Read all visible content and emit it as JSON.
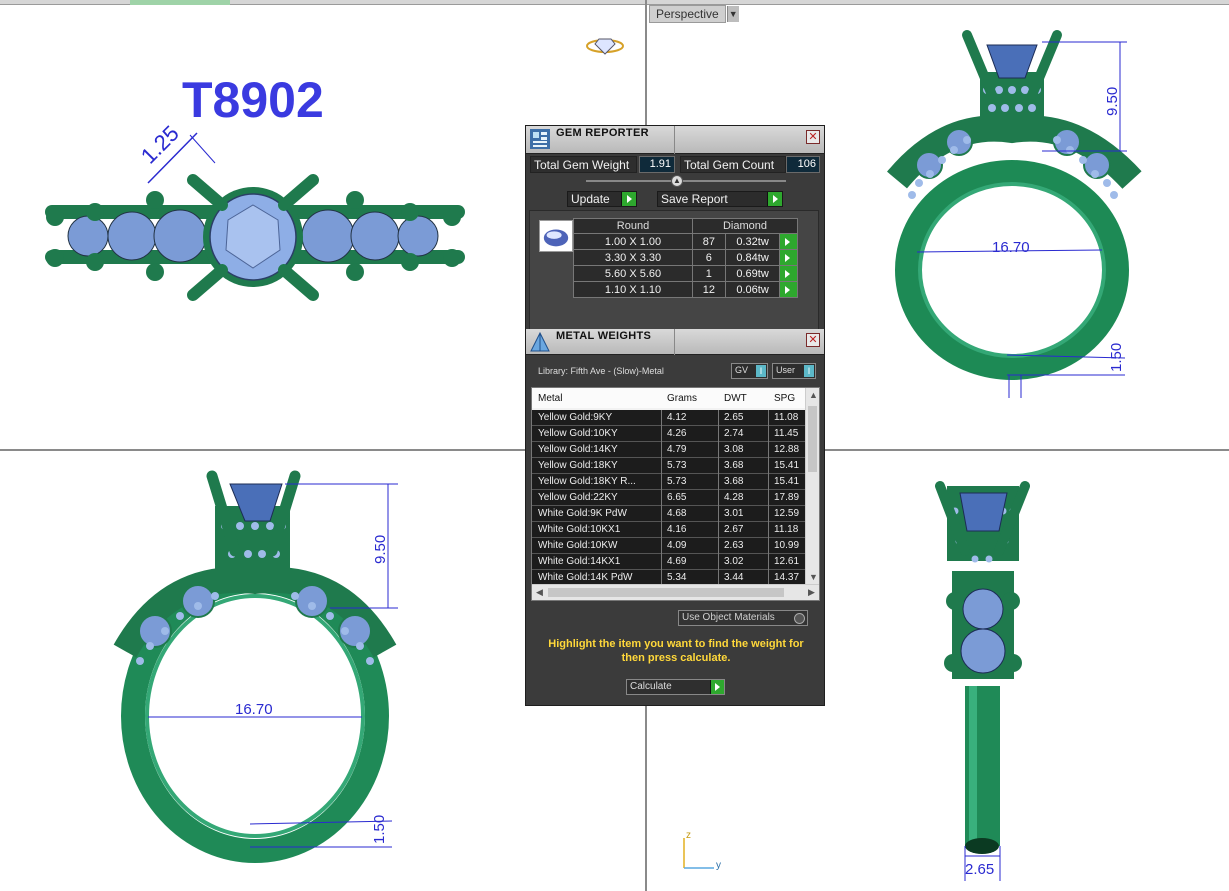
{
  "viewport": {
    "perspective_label": "Perspective"
  },
  "model": {
    "title": "T8902",
    "dims": {
      "prong": "1.25",
      "height": "9.50",
      "finger": "16.70",
      "band": "1.50",
      "shank": "2.65"
    }
  },
  "gem_reporter": {
    "title": "GEM REPORTER",
    "total_weight_label": "Total Gem Weight",
    "total_weight": "1.91",
    "total_count_label": "Total Gem Count",
    "total_count": "106",
    "update_label": "Update",
    "save_label": "Save Report",
    "col_shape": "Round",
    "col_type": "Diamond",
    "rows": [
      {
        "size": "1.00 X 1.00",
        "count": "87",
        "weight": "0.32tw"
      },
      {
        "size": "3.30 X 3.30",
        "count": "6",
        "weight": "0.84tw"
      },
      {
        "size": "5.60 X 5.60",
        "count": "1",
        "weight": "0.69tw"
      },
      {
        "size": "1.10 X 1.10",
        "count": "12",
        "weight": "0.06tw"
      }
    ]
  },
  "metal_weights": {
    "title": "METAL WEIGHTS",
    "library": "Library: Fifth Ave - (Slow)-Metal",
    "gv_label": "GV",
    "user_label": "User",
    "headers": {
      "metal": "Metal",
      "grams": "Grams",
      "dwt": "DWT",
      "spg": "SPG"
    },
    "rows": [
      {
        "metal": "Yellow Gold:9KY",
        "grams": "4.12",
        "dwt": "2.65",
        "spg": "11.08"
      },
      {
        "metal": "Yellow Gold:10KY",
        "grams": "4.26",
        "dwt": "2.74",
        "spg": "11.45"
      },
      {
        "metal": "Yellow Gold:14KY",
        "grams": "4.79",
        "dwt": "3.08",
        "spg": "12.88"
      },
      {
        "metal": "Yellow Gold:18KY",
        "grams": "5.73",
        "dwt": "3.68",
        "spg": "15.41"
      },
      {
        "metal": "Yellow Gold:18KY R...",
        "grams": "5.73",
        "dwt": "3.68",
        "spg": "15.41"
      },
      {
        "metal": "Yellow Gold:22KY",
        "grams": "6.65",
        "dwt": "4.28",
        "spg": "17.89"
      },
      {
        "metal": "White Gold:9K PdW",
        "grams": "4.68",
        "dwt": "3.01",
        "spg": "12.59"
      },
      {
        "metal": "White Gold:10KX1",
        "grams": "4.16",
        "dwt": "2.67",
        "spg": "11.18"
      },
      {
        "metal": "White Gold:10KW",
        "grams": "4.09",
        "dwt": "2.63",
        "spg": "10.99"
      },
      {
        "metal": "White Gold:14KX1",
        "grams": "4.69",
        "dwt": "3.02",
        "spg": "12.61"
      },
      {
        "metal": "White Gold:14K PdW",
        "grams": "5.34",
        "dwt": "3.44",
        "spg": "14.37"
      }
    ],
    "use_object_label": "Use Object Materials",
    "hint": "Highlight the item you want to find the weight for then press calculate.",
    "calculate_label": "Calculate"
  },
  "axis": {
    "z": "z",
    "y": "y"
  },
  "colors": {
    "metal": "#1f8a57",
    "gem": "#7d9cd8",
    "dimension": "#2a2ad0"
  }
}
